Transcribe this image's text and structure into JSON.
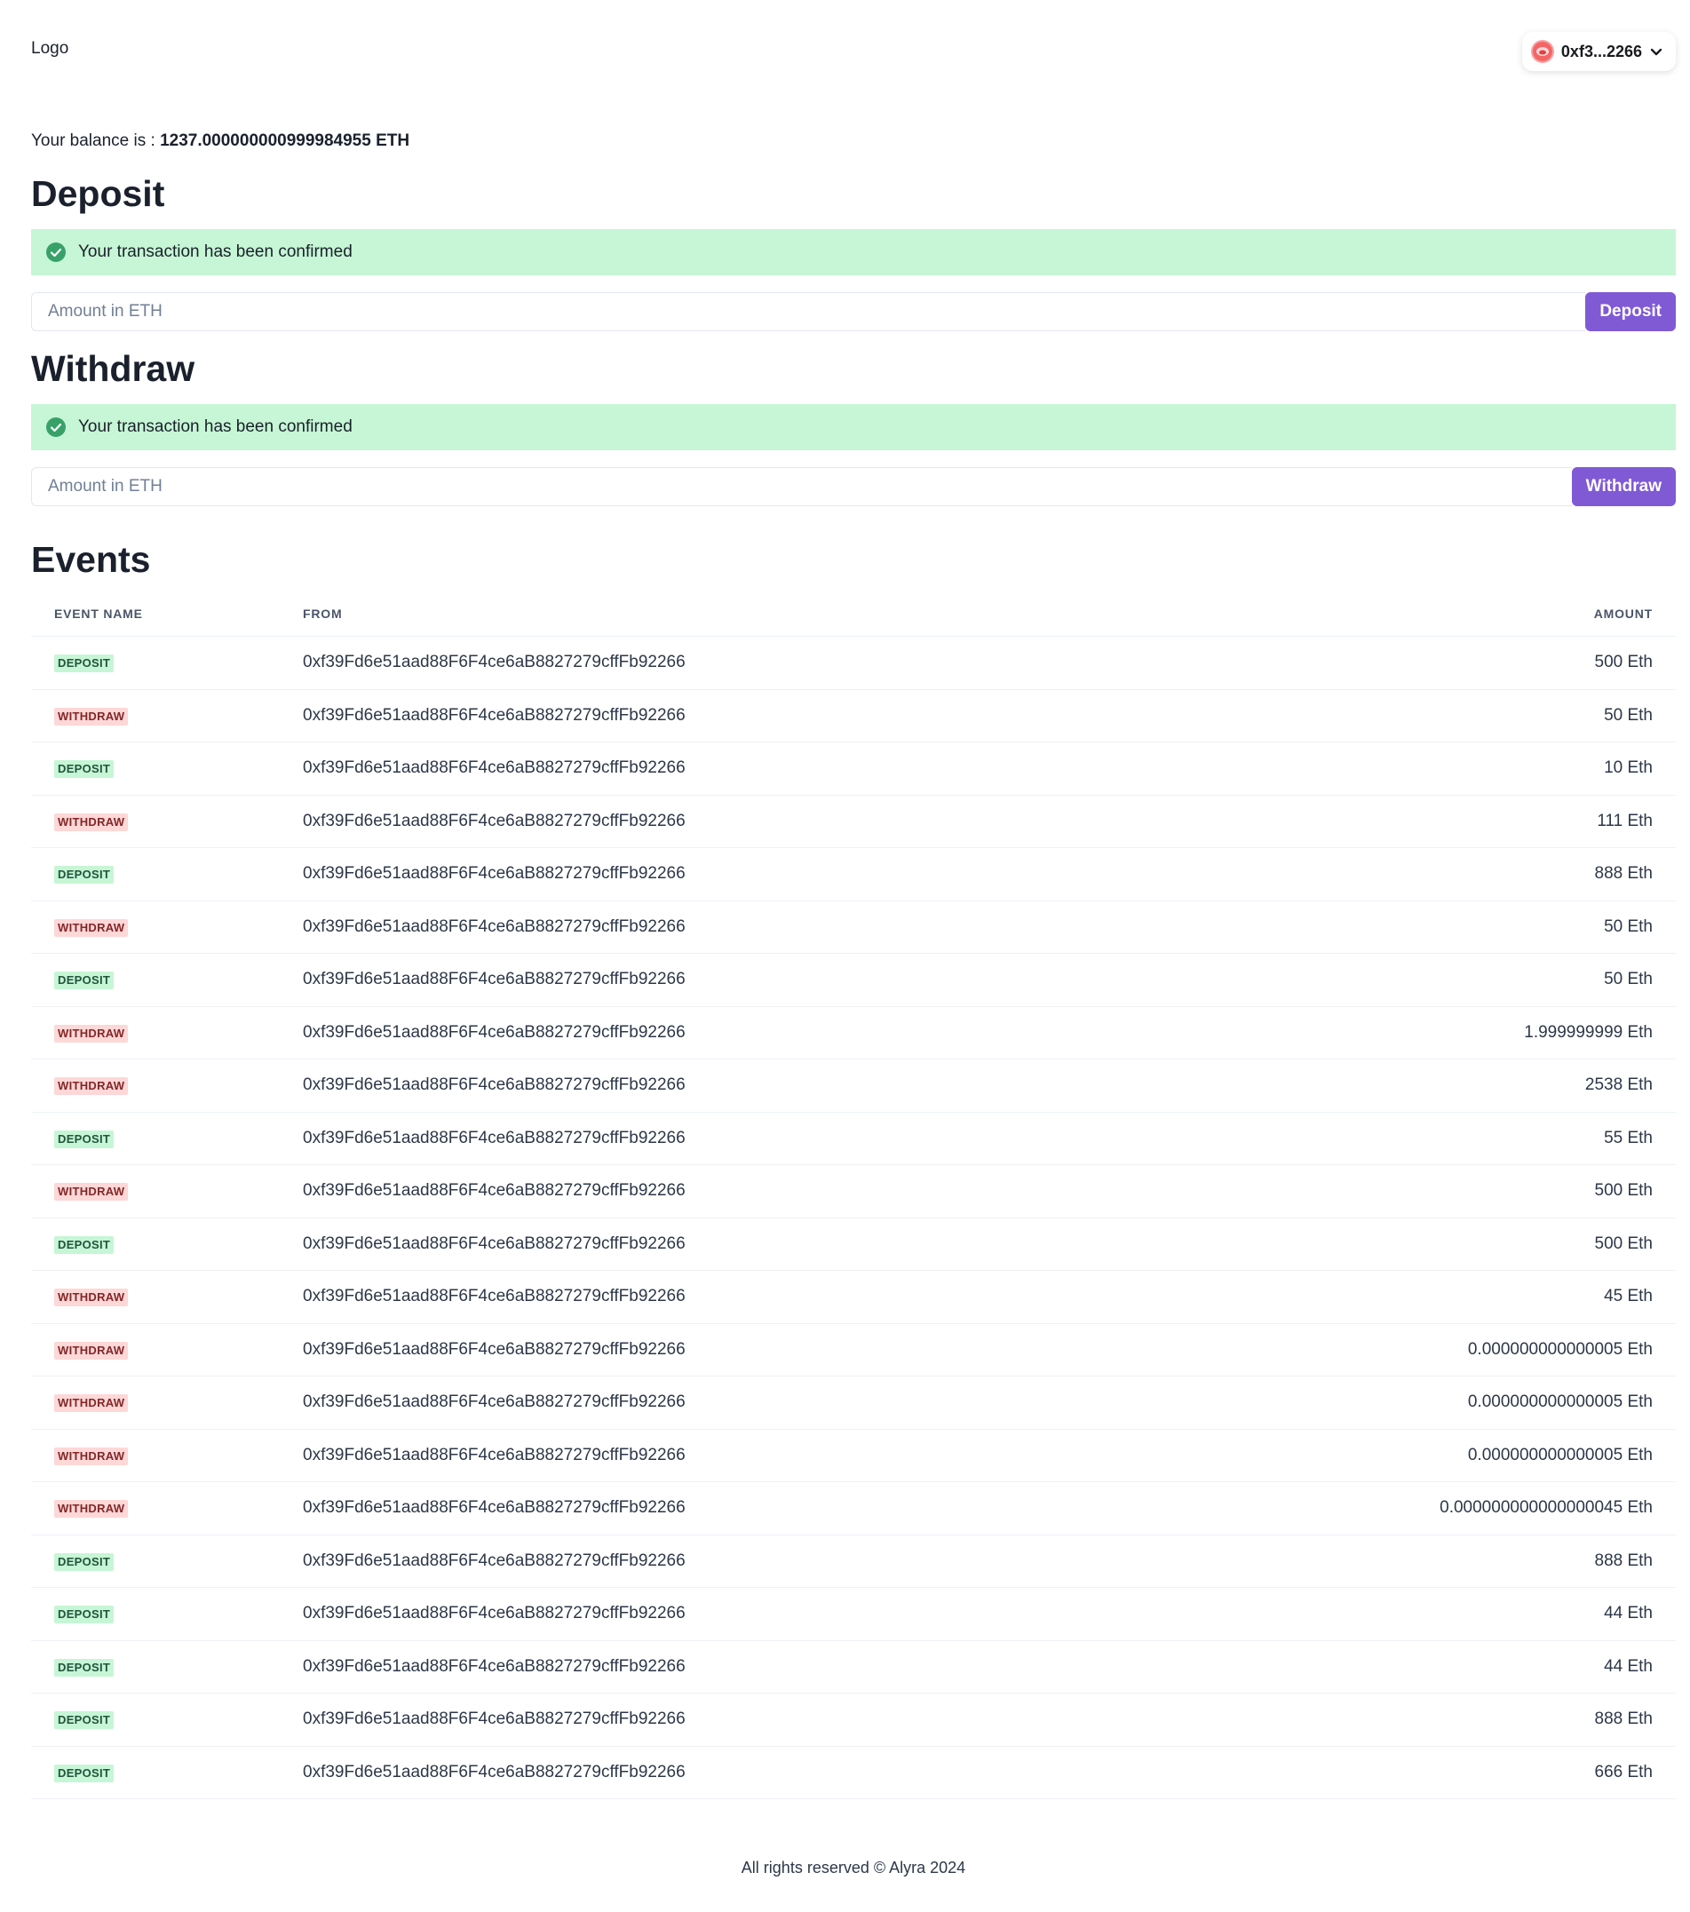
{
  "header": {
    "logo": "Logo",
    "account_label": "0xf3...2266"
  },
  "balance": {
    "label": "Your balance is : ",
    "value": "1237.000000000999984955 ETH"
  },
  "deposit": {
    "title": "Deposit",
    "alert": "Your transaction has been confirmed",
    "placeholder": "Amount in ETH",
    "button": "Deposit"
  },
  "withdraw": {
    "title": "Withdraw",
    "alert": "Your transaction has been confirmed",
    "placeholder": "Amount in ETH",
    "button": "Withdraw"
  },
  "events": {
    "title": "Events",
    "columns": [
      "EVENT NAME",
      "FROM",
      "AMOUNT"
    ],
    "rows": [
      {
        "type": "DEPOSIT",
        "from": "0xf39Fd6e51aad88F6F4ce6aB8827279cffFb92266",
        "amount": "500 Eth"
      },
      {
        "type": "WITHDRAW",
        "from": "0xf39Fd6e51aad88F6F4ce6aB8827279cffFb92266",
        "amount": "50 Eth"
      },
      {
        "type": "DEPOSIT",
        "from": "0xf39Fd6e51aad88F6F4ce6aB8827279cffFb92266",
        "amount": "10 Eth"
      },
      {
        "type": "WITHDRAW",
        "from": "0xf39Fd6e51aad88F6F4ce6aB8827279cffFb92266",
        "amount": "111 Eth"
      },
      {
        "type": "DEPOSIT",
        "from": "0xf39Fd6e51aad88F6F4ce6aB8827279cffFb92266",
        "amount": "888 Eth"
      },
      {
        "type": "WITHDRAW",
        "from": "0xf39Fd6e51aad88F6F4ce6aB8827279cffFb92266",
        "amount": "50 Eth"
      },
      {
        "type": "DEPOSIT",
        "from": "0xf39Fd6e51aad88F6F4ce6aB8827279cffFb92266",
        "amount": "50 Eth"
      },
      {
        "type": "WITHDRAW",
        "from": "0xf39Fd6e51aad88F6F4ce6aB8827279cffFb92266",
        "amount": "1.999999999 Eth"
      },
      {
        "type": "WITHDRAW",
        "from": "0xf39Fd6e51aad88F6F4ce6aB8827279cffFb92266",
        "amount": "2538 Eth"
      },
      {
        "type": "DEPOSIT",
        "from": "0xf39Fd6e51aad88F6F4ce6aB8827279cffFb92266",
        "amount": "55 Eth"
      },
      {
        "type": "WITHDRAW",
        "from": "0xf39Fd6e51aad88F6F4ce6aB8827279cffFb92266",
        "amount": "500 Eth"
      },
      {
        "type": "DEPOSIT",
        "from": "0xf39Fd6e51aad88F6F4ce6aB8827279cffFb92266",
        "amount": "500 Eth"
      },
      {
        "type": "WITHDRAW",
        "from": "0xf39Fd6e51aad88F6F4ce6aB8827279cffFb92266",
        "amount": "45 Eth"
      },
      {
        "type": "WITHDRAW",
        "from": "0xf39Fd6e51aad88F6F4ce6aB8827279cffFb92266",
        "amount": "0.000000000000005 Eth"
      },
      {
        "type": "WITHDRAW",
        "from": "0xf39Fd6e51aad88F6F4ce6aB8827279cffFb92266",
        "amount": "0.000000000000005 Eth"
      },
      {
        "type": "WITHDRAW",
        "from": "0xf39Fd6e51aad88F6F4ce6aB8827279cffFb92266",
        "amount": "0.000000000000005 Eth"
      },
      {
        "type": "WITHDRAW",
        "from": "0xf39Fd6e51aad88F6F4ce6aB8827279cffFb92266",
        "amount": "0.000000000000000045 Eth"
      },
      {
        "type": "DEPOSIT",
        "from": "0xf39Fd6e51aad88F6F4ce6aB8827279cffFb92266",
        "amount": "888 Eth"
      },
      {
        "type": "DEPOSIT",
        "from": "0xf39Fd6e51aad88F6F4ce6aB8827279cffFb92266",
        "amount": "44 Eth"
      },
      {
        "type": "DEPOSIT",
        "from": "0xf39Fd6e51aad88F6F4ce6aB8827279cffFb92266",
        "amount": "44 Eth"
      },
      {
        "type": "DEPOSIT",
        "from": "0xf39Fd6e51aad88F6F4ce6aB8827279cffFb92266",
        "amount": "888 Eth"
      },
      {
        "type": "DEPOSIT",
        "from": "0xf39Fd6e51aad88F6F4ce6aB8827279cffFb92266",
        "amount": "666 Eth"
      }
    ]
  },
  "footer": {
    "text": "All rights reserved © Alyra 2024"
  },
  "colors": {
    "accent": "#805ad5",
    "success_bg": "#c6f6d5",
    "success_icon": "#38a169",
    "deposit_badge_bg": "#c6f6d5",
    "withdraw_badge_bg": "#fed7d7"
  },
  "icons": {
    "alert": "check-circle-icon",
    "account": "avatar-icon",
    "account_menu": "chevron-down-icon"
  }
}
